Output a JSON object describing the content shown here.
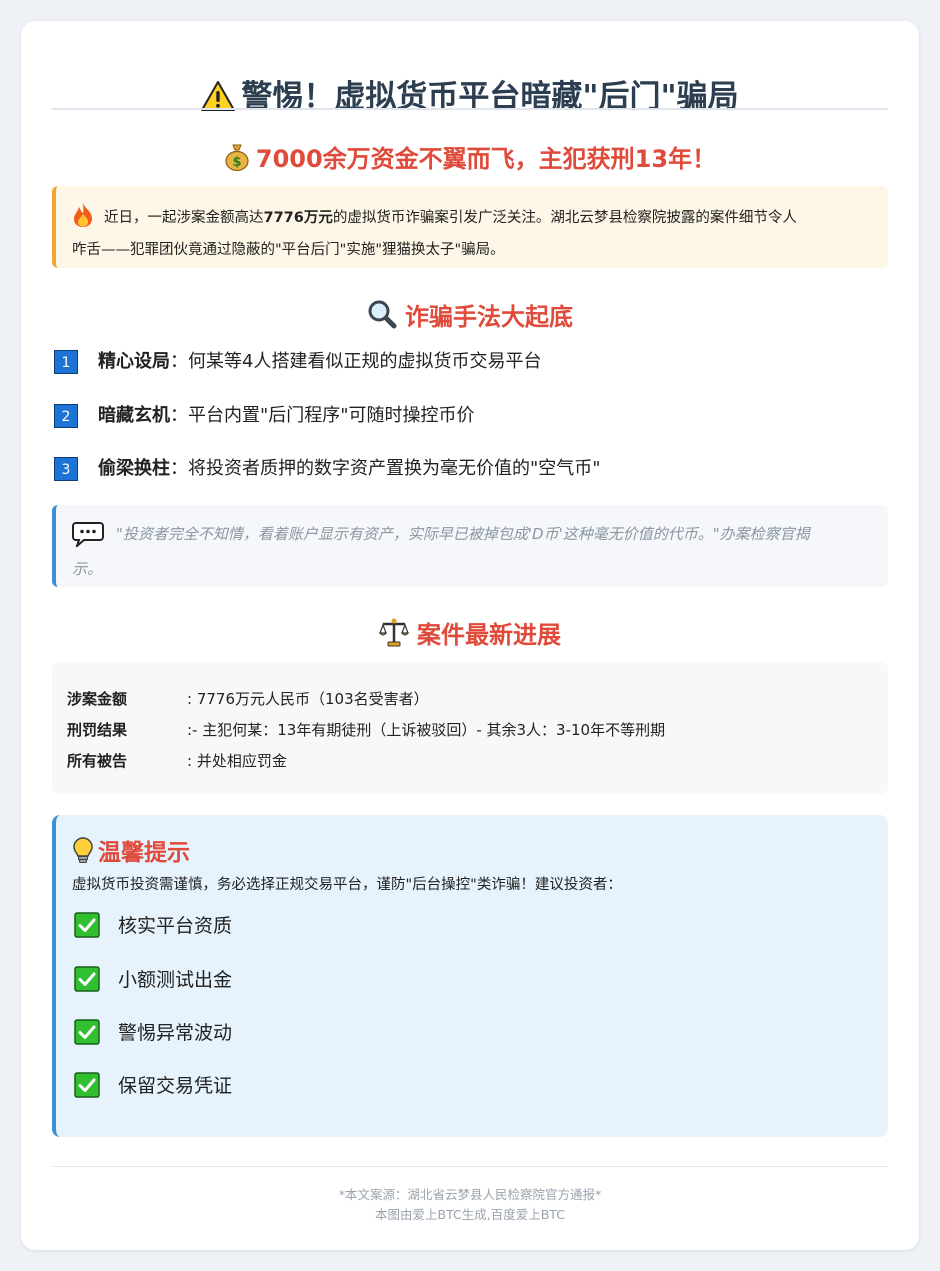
{
  "header": {
    "title": "警惕！虚拟货币平台暗藏\"后门\"骗局",
    "title_icon": "warning-icon"
  },
  "subtitle": {
    "text": "7000余万资金不翼而飞，主犯获刑13年！",
    "icon": "money-bag-icon"
  },
  "intro": {
    "icon": "fire-icon",
    "before": "近日，一起涉案金额高达",
    "amount": "7776万元",
    "after_line1": "的虚拟货币诈骗案引发广泛关注。湖北云梦县检察院披露的案件细节令人",
    "line2": "咋舌——犯罪团伙竟通过隐蔽的\"平台后门\"实施\"狸猫换太子\"骗局。"
  },
  "methods": {
    "title": "诈骗手法大起底",
    "icon": "magnifier-icon",
    "steps": [
      {
        "num": "1",
        "label": "精心设局",
        "text": "：何某等4人搭建看似正规的虚拟货币交易平台"
      },
      {
        "num": "2",
        "label": "暗藏玄机",
        "text": "：平台内置\"后门程序\"可随时操控币价"
      },
      {
        "num": "3",
        "label": "偷梁换柱",
        "text": "：将投资者质押的数字资产置换为毫无价值的\"空气币\""
      }
    ]
  },
  "quote": {
    "icon": "speech-bubble-icon",
    "line1": "\"投资者完全不知情，看着账户显示有资产，实际早已被掉包成'D币'这种毫无价值的代币。\"办案检察官揭",
    "line2": "示。"
  },
  "progress": {
    "title": "案件最新进展",
    "icon": "scales-icon",
    "facts": [
      {
        "key": "涉案金额",
        "value": ": 7776万元人民币（103名受害者）"
      },
      {
        "key": "刑罚结果",
        "value": ":- 主犯何某：13年有期徒刑（上诉被驳回）- 其余3人：3-10年不等刑期"
      },
      {
        "key": "所有被告",
        "value": ": 并处相应罚金"
      }
    ]
  },
  "tips": {
    "title": "温馨提示",
    "icon": "lightbulb-icon",
    "desc": "虚拟货币投资需谨慎，务必选择正规交易平台，谨防\"后台操控\"类诈骗！建议投资者：",
    "items": [
      "核实平台资质",
      "小额测试出金",
      "警惕异常波动",
      "保留交易凭证"
    ]
  },
  "footer": {
    "source": "*本文案源：湖北省云梦县人民检察院官方通报*",
    "credit": "本图由爱上BTC生成,百度爱上BTC"
  },
  "colors": {
    "accent_red": "#e04a3a",
    "title_dark": "#2c3e50",
    "blue": "#3b8fd6",
    "orange": "#f0a830"
  }
}
